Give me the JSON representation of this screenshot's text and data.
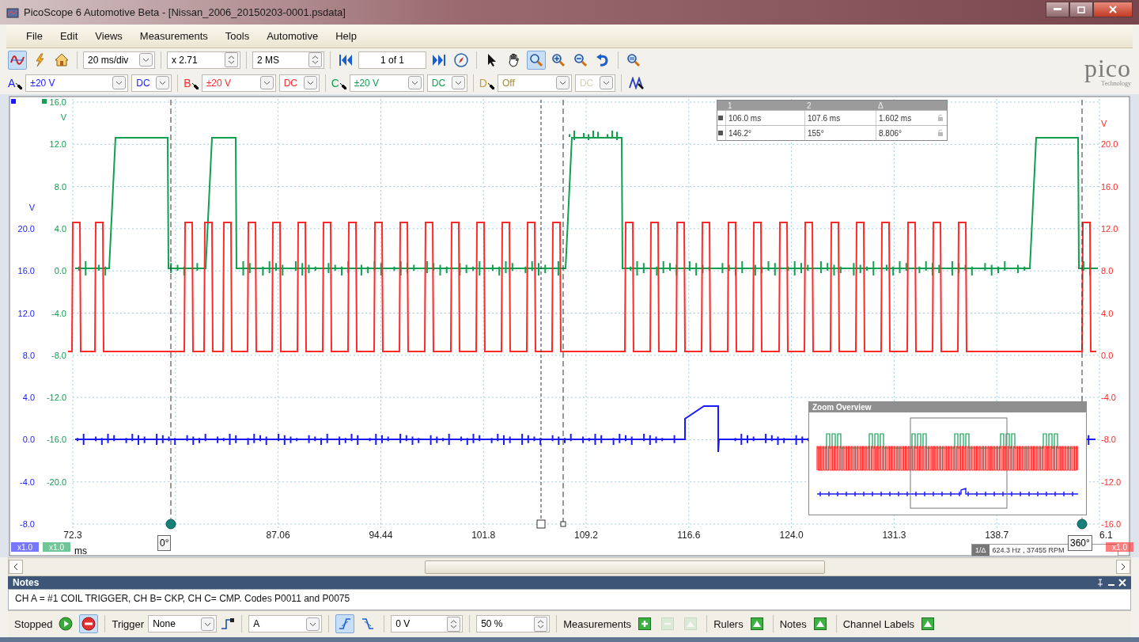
{
  "window": {
    "title": "PicoScope 6 Automotive Beta - [Nissan_2006_20150203-0001.psdata]"
  },
  "menu": [
    "File",
    "Edit",
    "Views",
    "Measurements",
    "Tools",
    "Automotive",
    "Help"
  ],
  "logo": {
    "name": "pico",
    "tagline": "Technology"
  },
  "toolbar": {
    "modes": [
      {
        "kind": "scope",
        "selected": true
      },
      {
        "kind": "lightning",
        "selected": false
      },
      {
        "kind": "home",
        "selected": false
      }
    ],
    "timebase": "20 ms/div",
    "zoom_factor": "x 2.71",
    "samples": "2 MS",
    "buffer_position": "1 of 1",
    "tools": [
      {
        "kind": "pointer",
        "selected": false
      },
      {
        "kind": "hand",
        "selected": false
      },
      {
        "kind": "zoom-box",
        "selected": true
      },
      {
        "kind": "zoom-in",
        "selected": false
      },
      {
        "kind": "zoom-out",
        "selected": false
      },
      {
        "kind": "undo",
        "selected": false
      }
    ]
  },
  "channels": [
    {
      "letter": "A",
      "range": "±20 V",
      "coupling": "DC",
      "color": "#1a1aff",
      "enabled": true
    },
    {
      "letter": "B",
      "range": "±20 V",
      "coupling": "DC",
      "color": "#ff2a2a",
      "enabled": true
    },
    {
      "letter": "C",
      "range": "±20 V",
      "coupling": "DC",
      "color": "#10a050",
      "enabled": true
    },
    {
      "letter": "D",
      "range": "Off",
      "coupling": "DC",
      "color": "#c8a040",
      "enabled": false
    }
  ],
  "scope": {
    "axes": [
      {
        "color": "#1a1aff",
        "unit": "V",
        "scale": "x1.0",
        "ticks": [
          "20.0",
          "16.0",
          "12.0",
          "8.0",
          "4.0",
          "0.0",
          "-4.0",
          "-8.0"
        ]
      },
      {
        "color": "#10a050",
        "unit": "V",
        "scale": "x1.0",
        "ticks": [
          "16.0",
          "12.0",
          "8.0",
          "4.0",
          "0.0",
          "-4.0",
          "-8.0",
          "-12.0",
          "-16.0",
          "-20.0"
        ]
      },
      {
        "color": "#ff2a2a",
        "unit": "V",
        "scale": "x1.0",
        "ticks": [
          "20.0",
          "16.0",
          "12.0",
          "8.0",
          "4.0",
          "0.0",
          "-4.0",
          "-8.0",
          "-12.0",
          "-16.0"
        ]
      }
    ],
    "x_ticks": [
      "72.3",
      "87.06",
      "94.44",
      "101.8",
      "109.2",
      "116.6",
      "124.0",
      "131.3",
      "138.7",
      "6.1"
    ],
    "x_unit": "ms",
    "phase_rulers": [
      {
        "label": "0°"
      },
      {
        "label": "360°"
      }
    ],
    "ruler_table": {
      "columns": [
        "1",
        "2",
        "Δ"
      ],
      "rows": [
        [
          "106.0 ms",
          "107.6 ms",
          "1.602 ms"
        ],
        [
          "146.2°",
          "155°",
          "8.806°"
        ]
      ]
    },
    "frequency": {
      "label": "1/Δ",
      "value": "624.3 Hz , 37455 RPM"
    },
    "zoom_overview": {
      "title": "Zoom Overview"
    }
  },
  "notes": {
    "title": "Notes",
    "text": "CH A = #1 COIL TRIGGER, CH B= CKP, CH C= CMP. Codes P0011 and P0075"
  },
  "status_bar": {
    "state": "Stopped",
    "run_buttons": [
      {
        "kind": "start",
        "selected": false
      },
      {
        "kind": "stop",
        "selected": true
      }
    ],
    "trigger_label": "Trigger",
    "trigger_mode": "None",
    "trigger_channel": "A",
    "edges": [
      {
        "kind": "rising",
        "selected": true
      },
      {
        "kind": "falling",
        "selected": false
      }
    ],
    "threshold": "0 V",
    "pretrigger": "50 %",
    "panels": [
      {
        "label": "Measurements",
        "buttons": [
          {
            "kind": "add",
            "disabled": false
          },
          {
            "kind": "edit",
            "disabled": true
          },
          {
            "kind": "remove",
            "disabled": true
          }
        ]
      },
      {
        "label": "Rulers",
        "buttons": [
          {
            "kind": "settings",
            "disabled": false
          }
        ]
      },
      {
        "label": "Notes",
        "buttons": [
          {
            "kind": "settings",
            "disabled": false
          }
        ]
      },
      {
        "label": "Channel Labels",
        "buttons": [
          {
            "kind": "settings",
            "disabled": false
          }
        ]
      }
    ]
  }
}
